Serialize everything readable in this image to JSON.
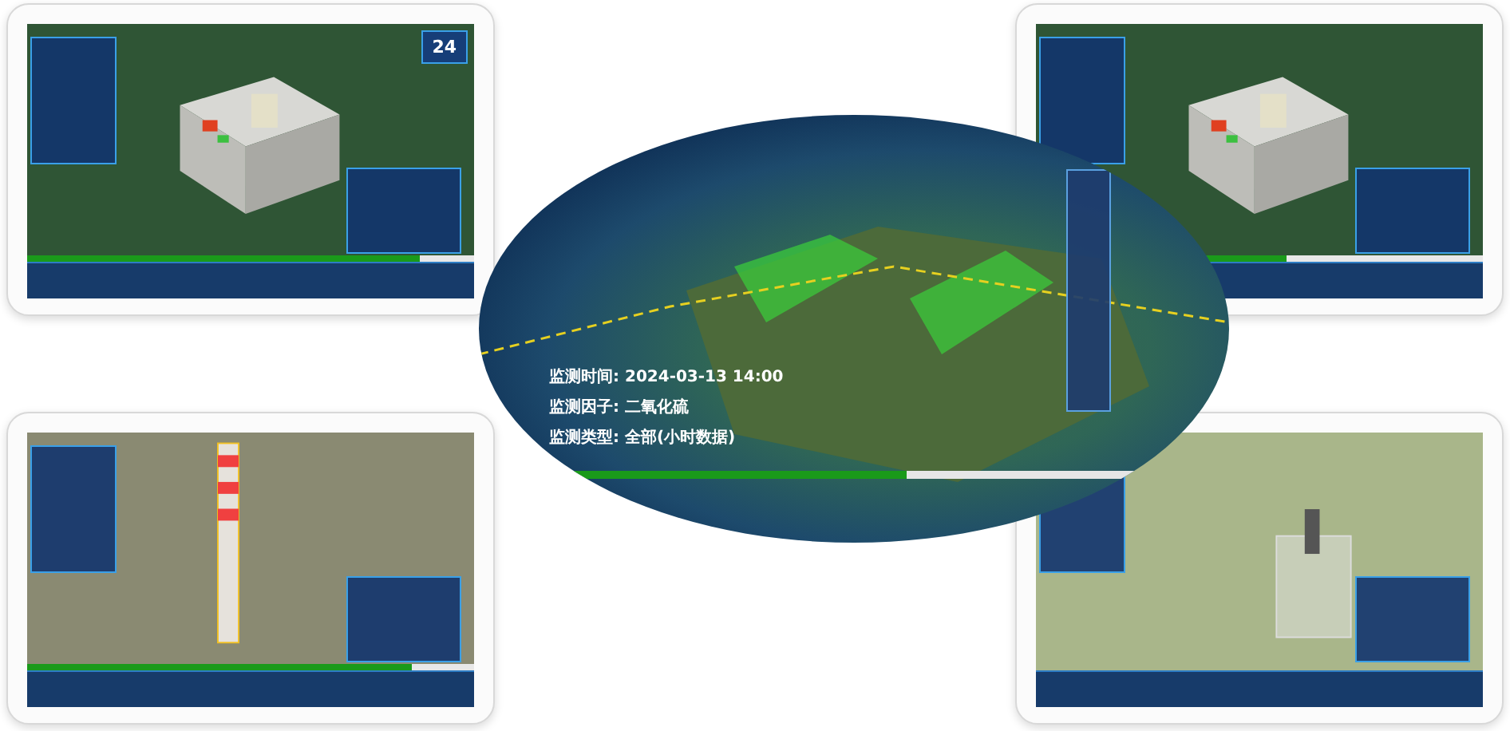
{
  "panels": [
    {
      "kind": "room",
      "badge": "24",
      "timeline": {
        "level": 0.88
      }
    },
    {
      "kind": "room",
      "timeline": {
        "level": 0.56
      }
    },
    {
      "kind": "chimney",
      "timeline": {
        "level": 0.86
      }
    },
    {
      "kind": "well"
    }
  ],
  "map": {
    "info": [
      "监测时间: 2024-03-13 14:00",
      "监测因子: 二氧化硫",
      "监测类型: 全部(小时数据)"
    ],
    "timeline": {
      "level": 0.6
    }
  }
}
